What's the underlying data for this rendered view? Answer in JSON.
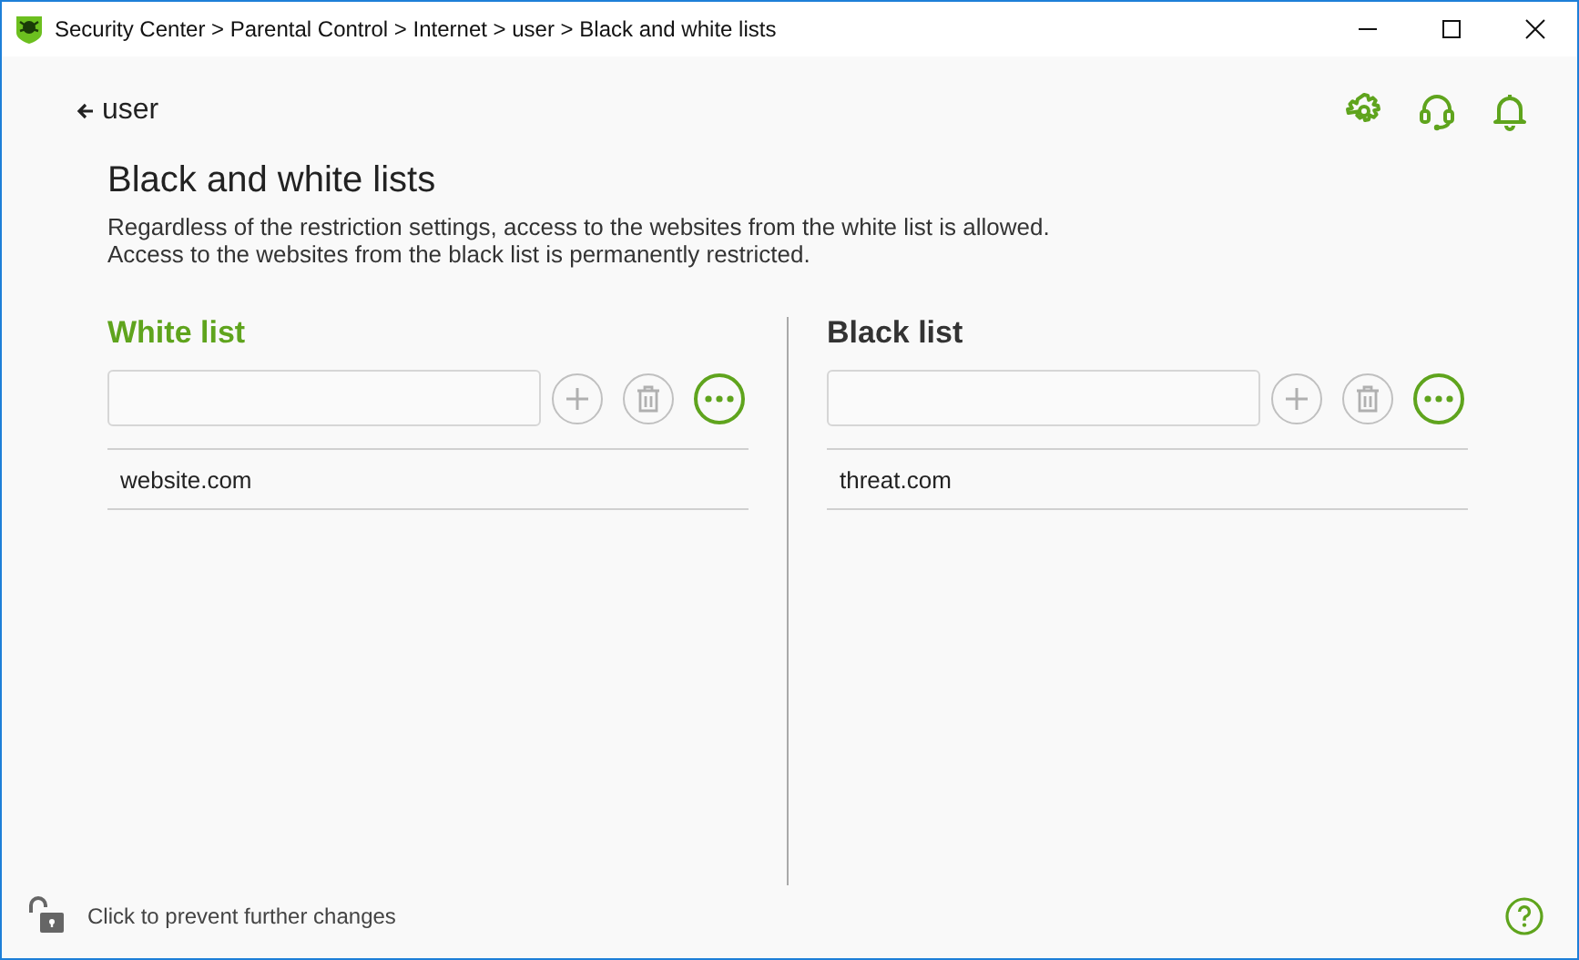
{
  "window": {
    "title": "Security Center > Parental Control > Internet > user > Black and white lists"
  },
  "back": {
    "label": "user"
  },
  "heading": "Black and white lists",
  "description": [
    "Regardless of the restriction settings, access to the websites from the white list is allowed.",
    "Access to the websites from the black list is permanently restricted."
  ],
  "lists": [
    {
      "title": "White list",
      "selected": true,
      "add_disabled": true,
      "delete_disabled": true,
      "items": [
        "website.com"
      ]
    },
    {
      "title": "Black list",
      "selected": false,
      "add_disabled": true,
      "delete_disabled": true,
      "items": [
        "threat.com"
      ]
    }
  ],
  "status_bar": {
    "text": "Click to prevent further changes",
    "locked": false
  }
}
